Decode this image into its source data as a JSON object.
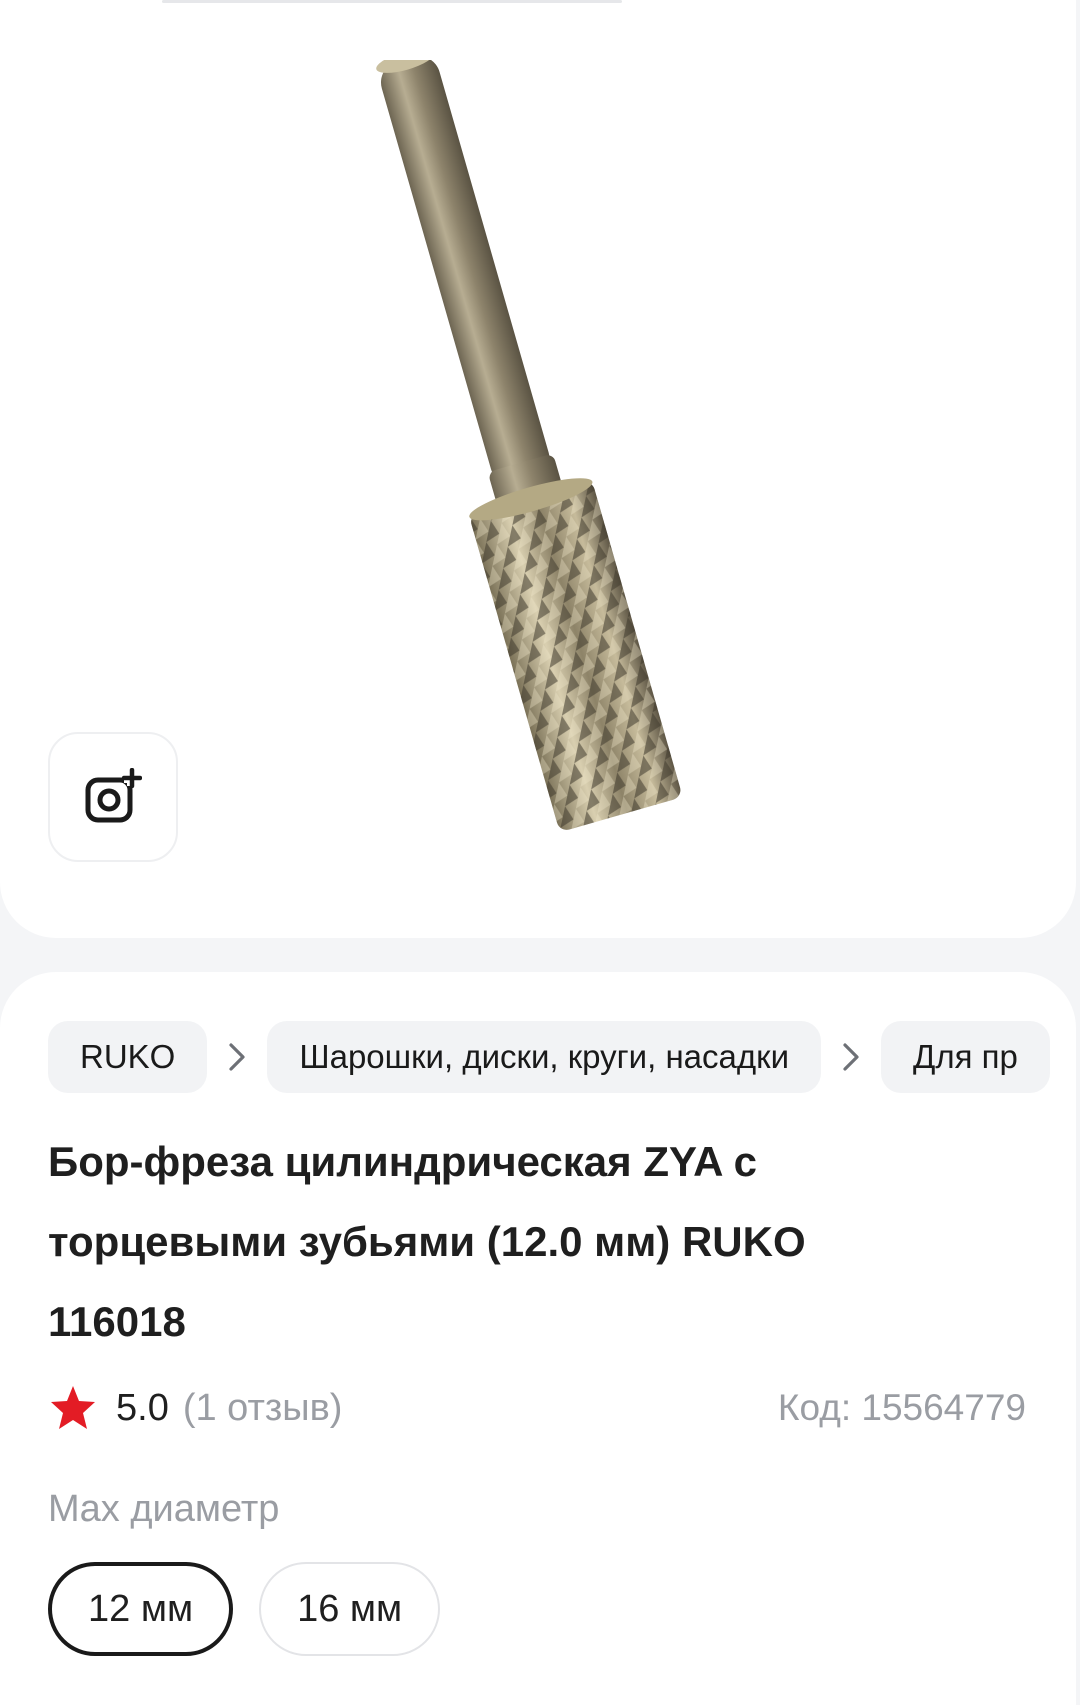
{
  "breadcrumbs": [
    {
      "label": "RUKO"
    },
    {
      "label": "Шарошки, диски, круги, насадки"
    },
    {
      "label": "Для пр"
    }
  ],
  "product": {
    "title": "Бор-фреза цилиндрическая ZYA с торцевыми зубьями (12.0 мм) RUKO 116018",
    "rating": "5.0",
    "reviews": "(1 отзыв)",
    "code": "Код: 15564779"
  },
  "variant": {
    "label": "Max диаметр",
    "options": [
      {
        "label": "12 мм",
        "selected": true
      },
      {
        "label": "16 мм",
        "selected": false
      }
    ]
  },
  "icons": {
    "add_photo": "camera-plus-icon",
    "separator": "chevron-right-icon",
    "rating": "star-icon"
  },
  "colors": {
    "star": "#e31c25",
    "muted_text": "#9a9da3",
    "selected_border": "#1a1a1a"
  }
}
